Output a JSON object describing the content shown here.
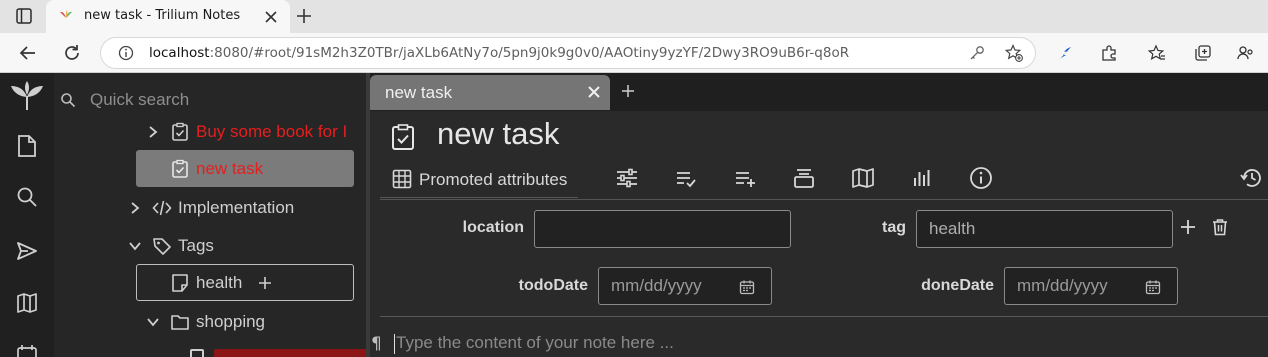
{
  "browser": {
    "tab_title": "new task - Trilium Notes",
    "url_host": "localhost",
    "url_rest": ":8080/#root/91sM2h3Z0TBr/jaXLb6AtNy7o/5pn9j0k9g0v0/AAOtiny9yzYF/2Dwy3RO9uB6r-q8oR"
  },
  "tree": {
    "search_placeholder": "Quick search",
    "items": [
      {
        "label": "Buy some book for I"
      },
      {
        "label": "new task"
      },
      {
        "label": "Implementation"
      },
      {
        "label": "Tags"
      },
      {
        "label": "health"
      },
      {
        "label": "shopping"
      }
    ]
  },
  "note": {
    "tab_label": "new task",
    "title": "new task",
    "ribbon_promoted_label": "Promoted attributes",
    "attributes": {
      "location_label": "location",
      "location_value": "",
      "tag_label": "tag",
      "tag_value": "health",
      "todo_label": "todoDate",
      "todo_placeholder": "mm/dd/yyyy",
      "done_label": "doneDate",
      "done_placeholder": "mm/dd/yyyy"
    },
    "editor_placeholder": "Type the content of your note here ..."
  },
  "colors": {
    "accent_red": "#e61e1e",
    "selected_bg": "#7b7b7b",
    "browser_blue": "#1b5fc2"
  }
}
